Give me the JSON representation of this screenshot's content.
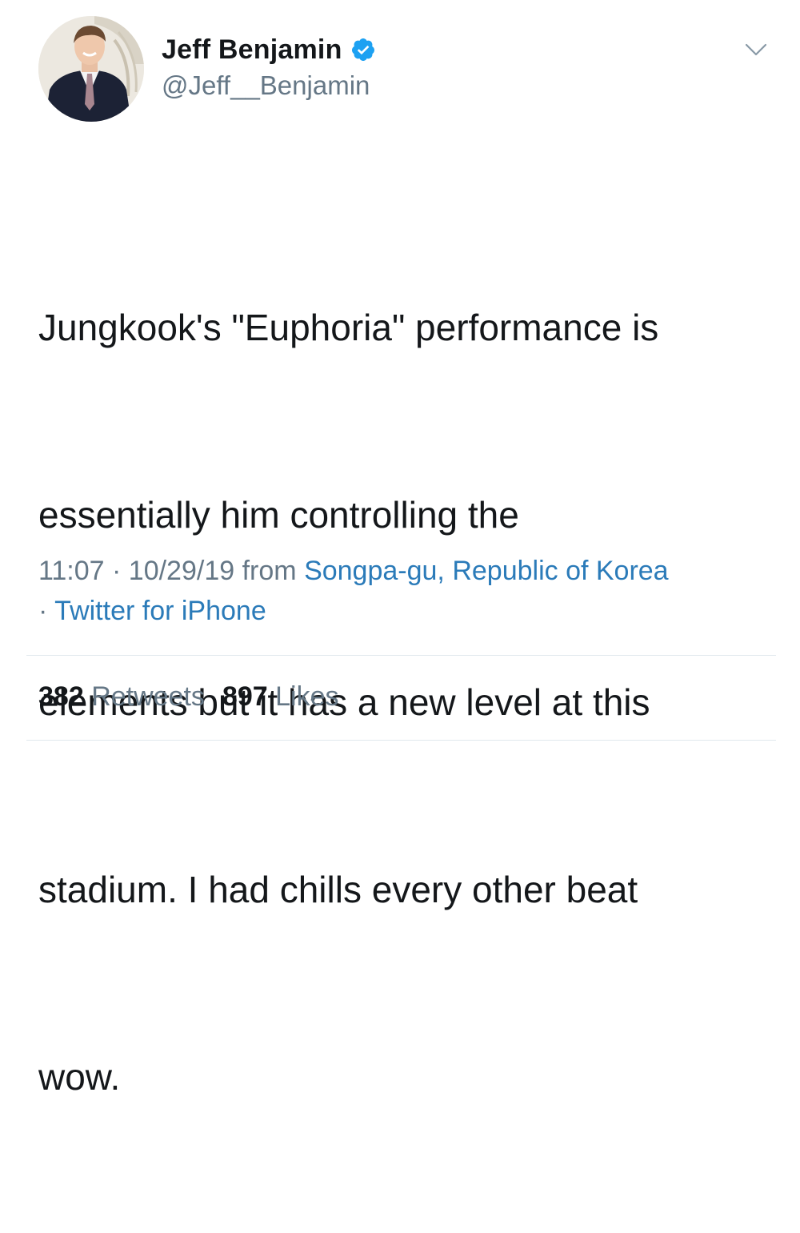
{
  "tweet": {
    "author": {
      "display_name": "Jeff Benjamin",
      "handle": "@Jeff__Benjamin",
      "verified": true
    },
    "text_lines": [
      "Jungkook's \"Euphoria\" performance is",
      "essentially him controlling the",
      "elements but it has a new level at this",
      "stadium. I had chills every other beat",
      "wow."
    ],
    "meta": {
      "time": "11:07",
      "date": "10/29/19",
      "from_label": "from",
      "location": "Songpa-gu, Republic of Korea",
      "source": "Twitter for iPhone",
      "separator": "·"
    },
    "stats": {
      "retweets_count": "382",
      "retweets_label": "Retweets",
      "likes_count": "897",
      "likes_label": "Likes"
    }
  },
  "colors": {
    "text_primary": "#14171a",
    "text_secondary": "#657786",
    "link": "#2b7bb9",
    "verified_badge": "#1da1f2",
    "divider": "#e1e8ed"
  },
  "icons": {
    "verified": "verified-badge-icon",
    "menu": "chevron-down-icon"
  }
}
